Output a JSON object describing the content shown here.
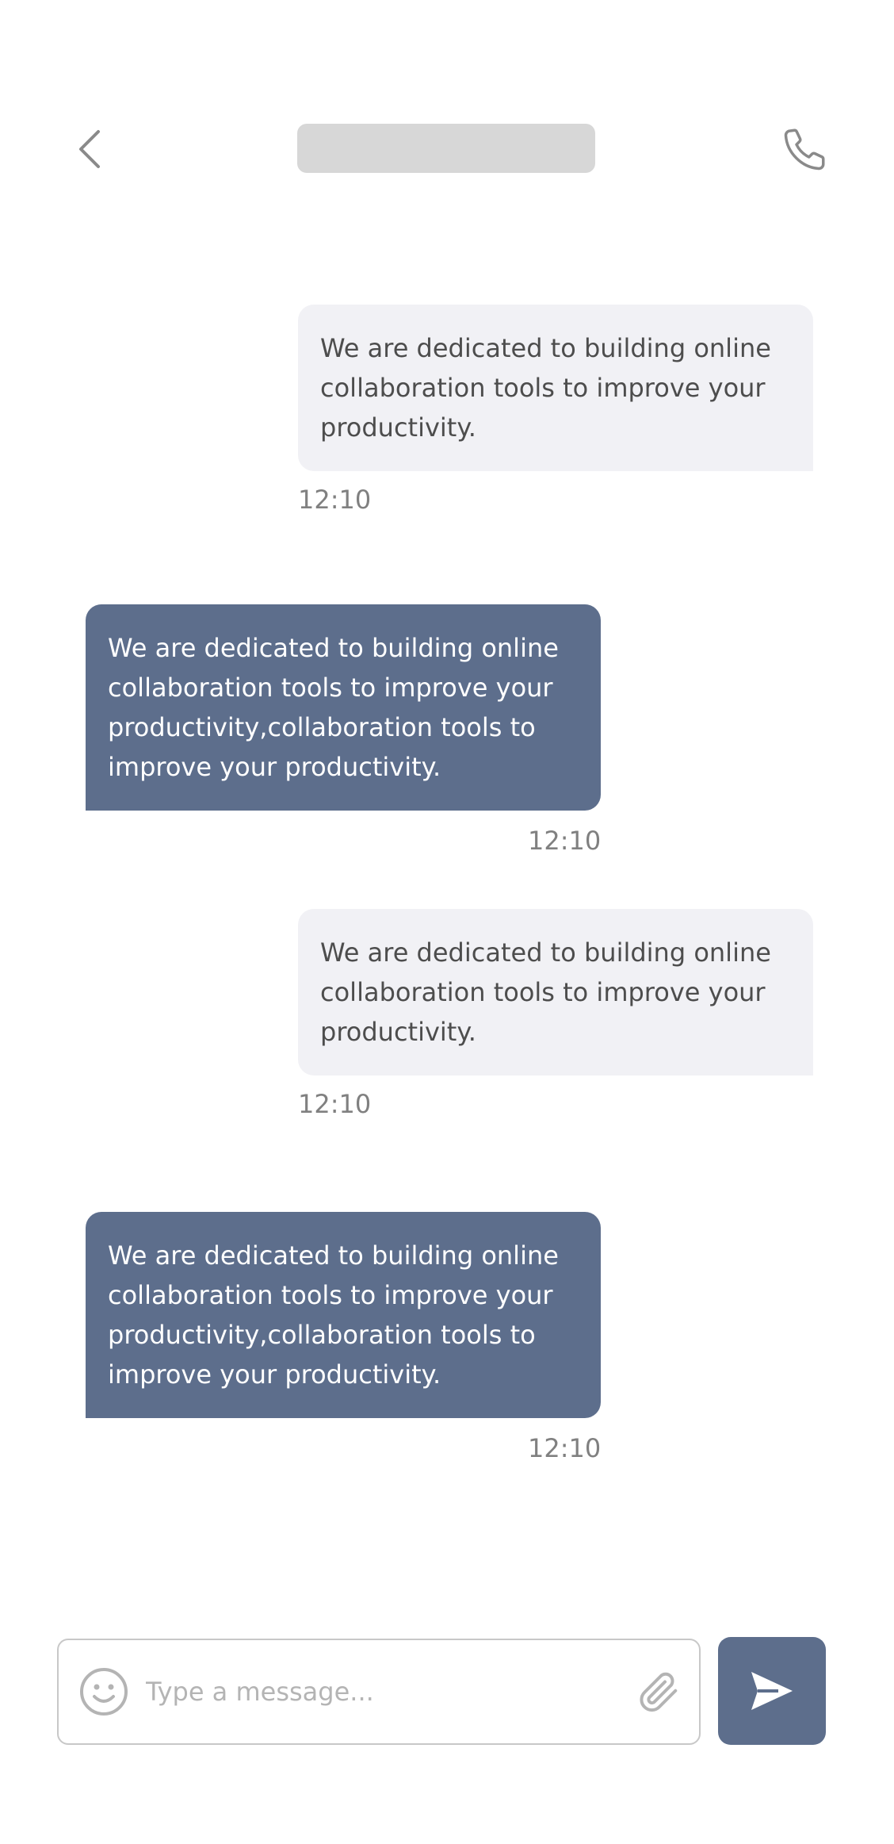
{
  "header": {
    "back_icon": "chevron-left-icon",
    "call_icon": "phone-icon"
  },
  "messages": [
    {
      "direction": "incoming",
      "text": "We are dedicated to building online collaboration tools to improve your productivity.",
      "time": "12:10"
    },
    {
      "direction": "outgoing",
      "text": "We are dedicated to building online collaboration tools to improve your productivity,collaboration tools to improve your productivity.",
      "time": "12:10"
    },
    {
      "direction": "incoming",
      "text": "We are dedicated to building online collaboration tools to improve your productivity.",
      "time": "12:10"
    },
    {
      "direction": "outgoing",
      "text": "We are dedicated to building online collaboration tools to improve your productivity,collaboration tools to improve your productivity.",
      "time": "12:10"
    }
  ],
  "composer": {
    "placeholder": "Type a message...",
    "emoji_icon": "smiley-icon",
    "attach_icon": "paperclip-icon",
    "send_icon": "send-icon"
  },
  "colors": {
    "accent": "#5d6e8c",
    "incoming_bubble": "#f1f1f5",
    "placeholder_bar": "#d7d7d7"
  }
}
